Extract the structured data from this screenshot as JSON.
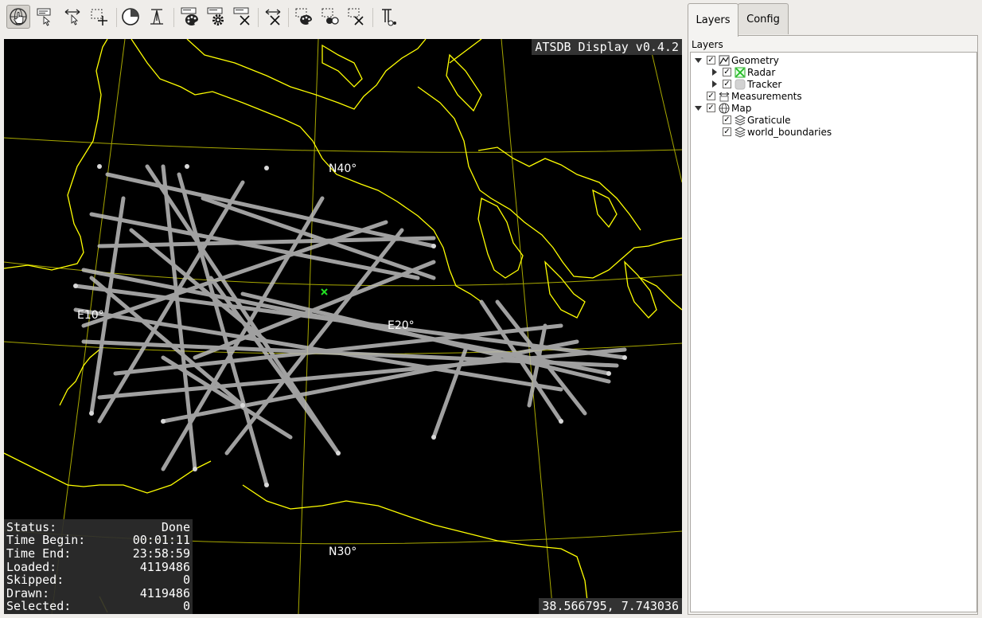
{
  "toolbar": {
    "buttons": [
      {
        "name": "navigate-tool",
        "icon": "globe-hand-icon",
        "active": true
      },
      {
        "name": "label-tool",
        "icon": "label-cursor-icon"
      },
      {
        "name": "measure-distance-tool",
        "icon": "arrows-cursor-icon"
      },
      {
        "name": "select-tool",
        "icon": "select-plus-icon"
      },
      {
        "name": "time-filter-tool",
        "icon": "clock-icon"
      },
      {
        "name": "altitude-tool",
        "icon": "altitude-icon"
      },
      {
        "name": "style-tool",
        "icon": "palette-icon"
      },
      {
        "name": "settings-tool",
        "icon": "gear-icon"
      },
      {
        "name": "clear-tool",
        "icon": "clear-x-icon"
      },
      {
        "name": "clear-measure-tool",
        "icon": "arrows-x-icon"
      },
      {
        "name": "select-style-tool",
        "icon": "select-palette-icon"
      },
      {
        "name": "select-filter-tool",
        "icon": "select-circles-icon"
      },
      {
        "name": "clear-selection-tool",
        "icon": "select-x-icon"
      },
      {
        "name": "text-tool",
        "icon": "text-icon"
      }
    ]
  },
  "map": {
    "version_label": "ATSDB Display v0.4.2",
    "graticule_labels": {
      "n40": "N40°",
      "n30": "N30°",
      "e10": "E10°",
      "e20": "E20°"
    },
    "coordinates": "38.566795, 7.743036",
    "colors": {
      "background": "#000000",
      "coastline": "#ffff00",
      "graticule": "#a8a800",
      "tracks": "#c8c8c8",
      "radar": "#22dd22"
    }
  },
  "status": {
    "rows": [
      {
        "label": "Status:",
        "value": "Done"
      },
      {
        "label": "Time Begin:",
        "value": "00:01:11"
      },
      {
        "label": "Time End:",
        "value": "23:58:59"
      },
      {
        "label": "Loaded:",
        "value": "4119486"
      },
      {
        "label": "Skipped:",
        "value": "0"
      },
      {
        "label": "Drawn:",
        "value": "4119486"
      },
      {
        "label": "Selected:",
        "value": "0"
      }
    ]
  },
  "panel": {
    "tabs": [
      {
        "label": "Layers",
        "active": true
      },
      {
        "label": "Config",
        "active": false
      }
    ],
    "layers_title": "Layers",
    "tree": [
      {
        "label": "Geometry",
        "level": 0,
        "expanded": true,
        "icon": "geometry-icon",
        "checked": true
      },
      {
        "label": "Radar",
        "level": 1,
        "collapsed": true,
        "icon": "radar-icon",
        "checked": true
      },
      {
        "label": "Tracker",
        "level": 1,
        "collapsed": true,
        "icon": "tracker-icon",
        "checked": true
      },
      {
        "label": "Measurements",
        "level": 0,
        "icon": "measurements-icon",
        "checked": true
      },
      {
        "label": "Map",
        "level": 0,
        "expanded": true,
        "icon": "globe-icon",
        "checked": true
      },
      {
        "label": "Graticule",
        "level": 1,
        "icon": "layers-icon",
        "checked": true
      },
      {
        "label": "world_boundaries",
        "level": 1,
        "icon": "layers-icon",
        "checked": true
      }
    ]
  }
}
